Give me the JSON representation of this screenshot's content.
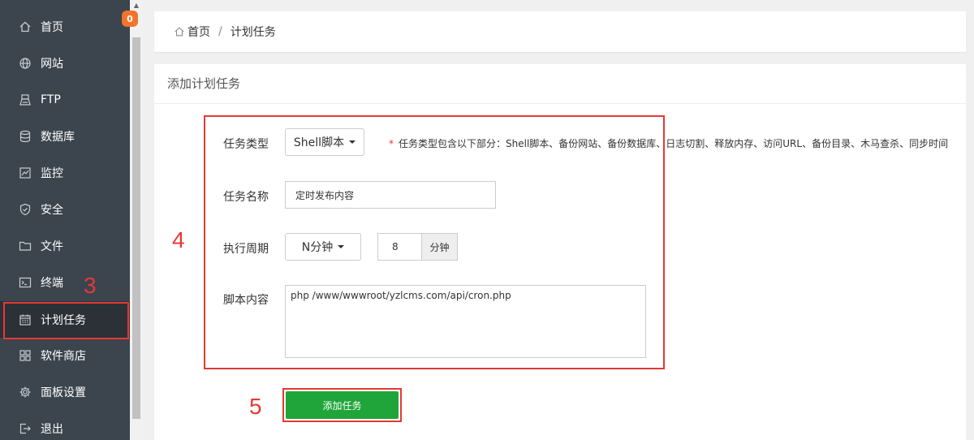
{
  "sidebar": {
    "badge": "0",
    "items": [
      {
        "label": "首页",
        "icon": "home-icon"
      },
      {
        "label": "网站",
        "icon": "globe-icon"
      },
      {
        "label": "FTP",
        "icon": "ftp-icon"
      },
      {
        "label": "数据库",
        "icon": "database-icon"
      },
      {
        "label": "监控",
        "icon": "monitor-icon"
      },
      {
        "label": "安全",
        "icon": "shield-icon"
      },
      {
        "label": "文件",
        "icon": "folder-icon"
      },
      {
        "label": "终端",
        "icon": "terminal-icon"
      },
      {
        "label": "计划任务",
        "icon": "calendar-icon"
      },
      {
        "label": "软件商店",
        "icon": "apps-icon"
      },
      {
        "label": "面板设置",
        "icon": "gear-icon"
      },
      {
        "label": "退出",
        "icon": "logout-icon"
      }
    ],
    "active_index": 8
  },
  "annotations": {
    "step3": "3",
    "step4": "4",
    "step5": "5"
  },
  "breadcrumb": {
    "home": "首页",
    "separator": "/",
    "current": "计划任务"
  },
  "form": {
    "title": "添加计划任务",
    "task_type_label": "任务类型",
    "task_type_value": "Shell脚本",
    "task_type_hint_star": "*",
    "task_type_hint": "任务类型包含以下部分：Shell脚本、备份网站、备份数据库、日志切割、释放内存、访问URL、备份目录、木马查杀、同步时间",
    "task_name_label": "任务名称",
    "task_name_value": "定时发布内容",
    "cycle_label": "执行周期",
    "cycle_value": "N分钟",
    "cycle_number": "8",
    "cycle_unit": "分钟",
    "script_label": "脚本内容",
    "script_value": "php /www/wwwroot/yzlcms.com/api/cron.php",
    "submit_label": "添加任务"
  },
  "colors": {
    "sidebar_bg": "#3c444d",
    "sidebar_active": "#2b3137",
    "accent_green": "#20a53a",
    "annotation_red": "#e53935",
    "badge_orange": "#f0742c"
  }
}
